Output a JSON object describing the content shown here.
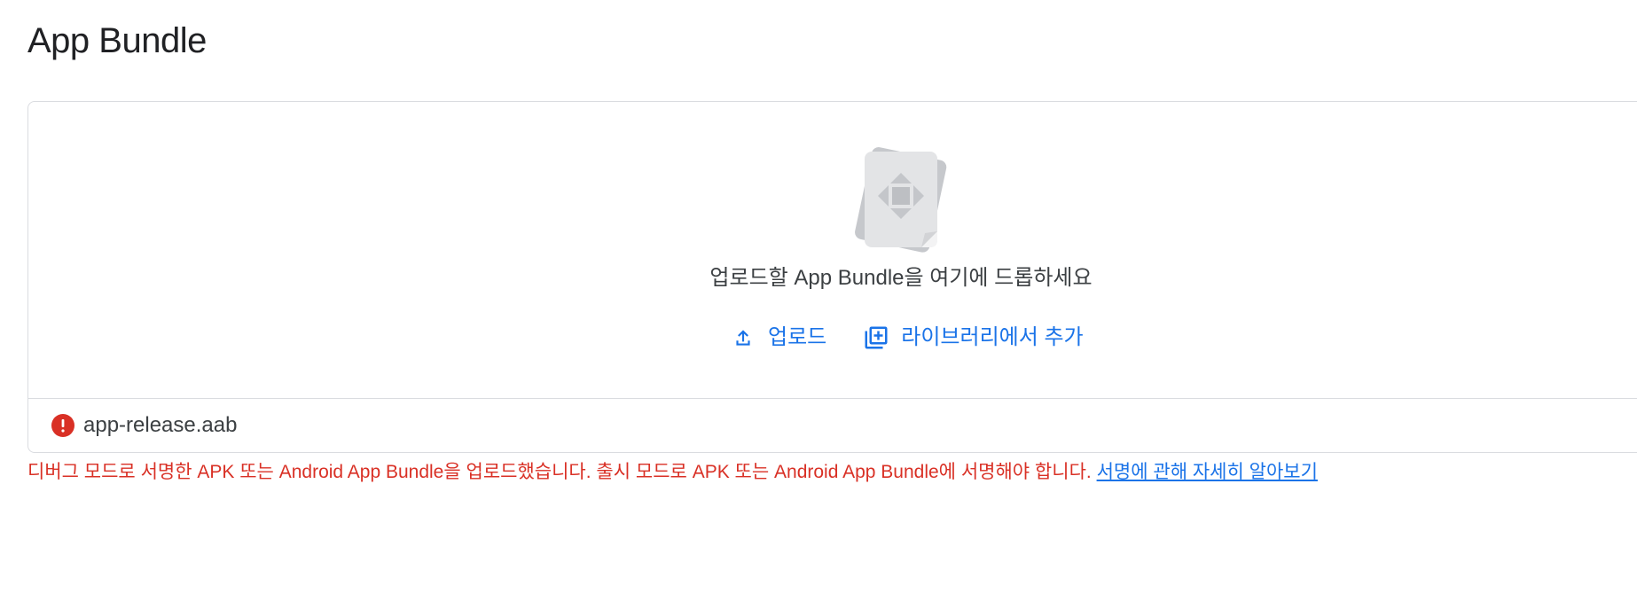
{
  "page": {
    "title": "App Bundle"
  },
  "dropzone": {
    "hint": "업로드할 App Bundle을 여기에 드롭하세요",
    "upload_label": "업로드",
    "add_from_library_label": "라이브러리에서 추가"
  },
  "file": {
    "name": "app-release.aab",
    "status_icon": "error-icon"
  },
  "error": {
    "message": "디버그 모드로 서명한 APK 또는 Android App Bundle을 업로드했습니다. 출시 모드로 APK 또는 Android App Bundle에 서명해야 합니다. ",
    "link_label": "서명에 관해 자세히 알아보기"
  },
  "colors": {
    "accent": "#1a73e8",
    "error": "#d93025",
    "border": "#dadce0",
    "text": "#202124"
  }
}
